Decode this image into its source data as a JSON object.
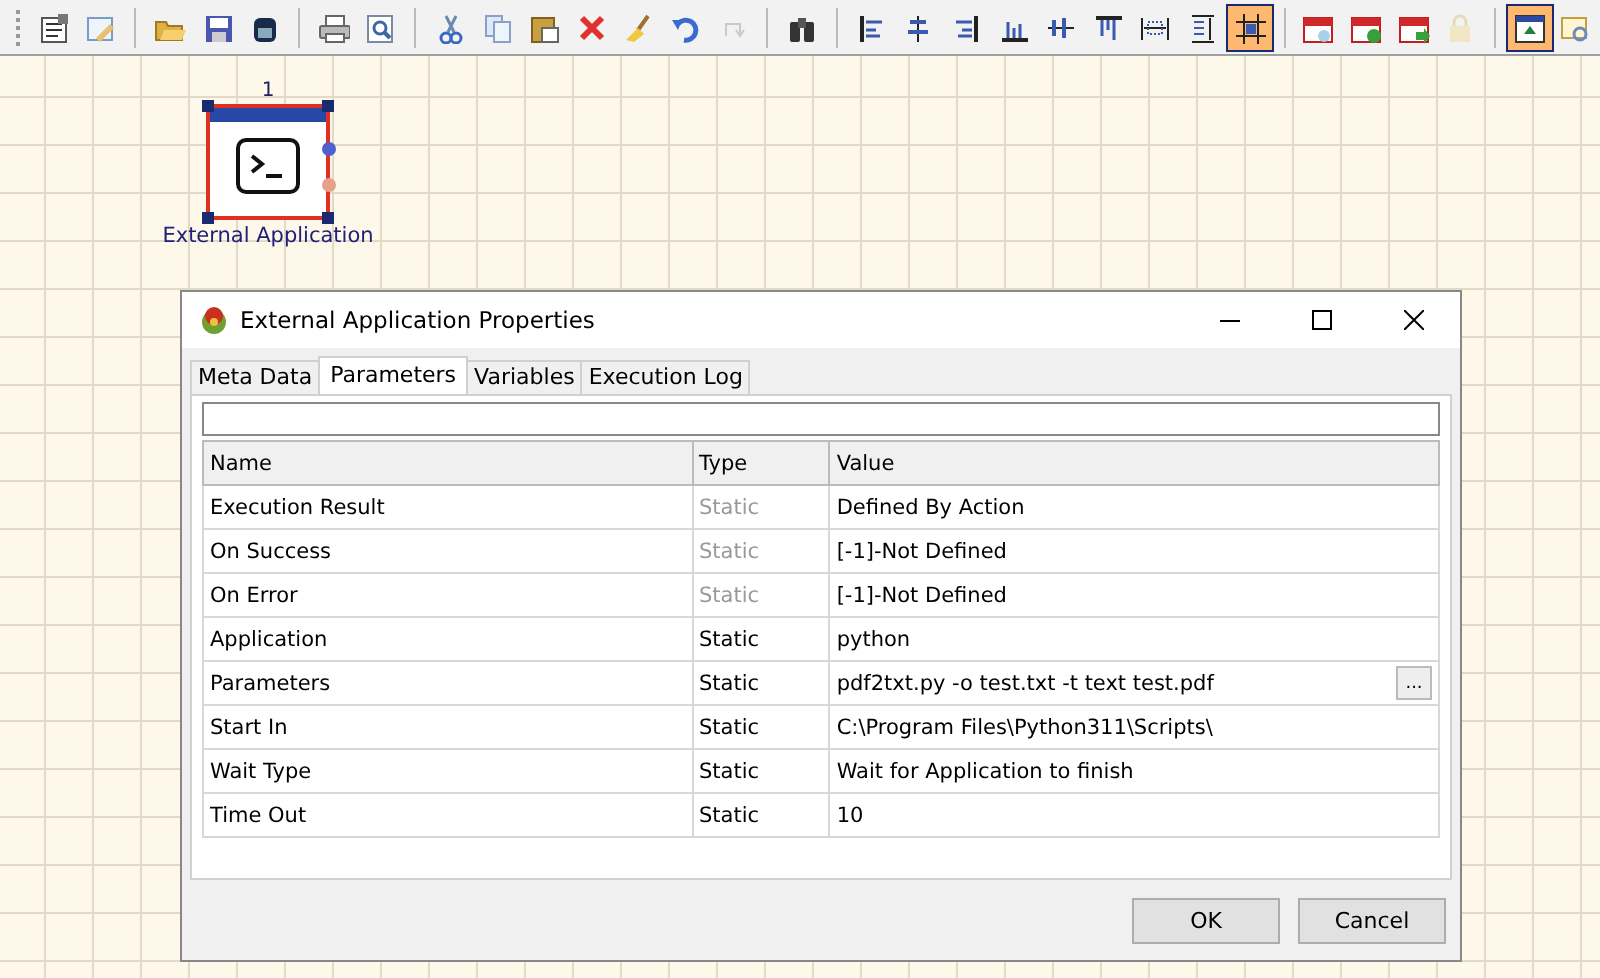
{
  "toolbar": [
    {
      "kind": "properties",
      "selected": false,
      "disabled": false
    },
    {
      "kind": "edit",
      "selected": false,
      "disabled": false
    },
    {
      "kind": "sep"
    },
    {
      "kind": "open",
      "selected": false,
      "disabled": false
    },
    {
      "kind": "save",
      "selected": false,
      "disabled": false
    },
    {
      "kind": "database",
      "selected": false,
      "disabled": false
    },
    {
      "kind": "sep"
    },
    {
      "kind": "print",
      "selected": false,
      "disabled": false
    },
    {
      "kind": "preview",
      "selected": false,
      "disabled": false
    },
    {
      "kind": "sep"
    },
    {
      "kind": "cut",
      "selected": false,
      "disabled": false
    },
    {
      "kind": "copy",
      "selected": false,
      "disabled": false
    },
    {
      "kind": "paste",
      "selected": false,
      "disabled": false
    },
    {
      "kind": "delete",
      "selected": false,
      "disabled": false
    },
    {
      "kind": "broom",
      "selected": false,
      "disabled": false
    },
    {
      "kind": "undo",
      "selected": false,
      "disabled": false
    },
    {
      "kind": "redo",
      "selected": false,
      "disabled": true
    },
    {
      "kind": "sep"
    },
    {
      "kind": "binoculars",
      "selected": false,
      "disabled": false
    },
    {
      "kind": "sep"
    },
    {
      "kind": "align-left",
      "selected": false,
      "disabled": false
    },
    {
      "kind": "align-center",
      "selected": false,
      "disabled": false
    },
    {
      "kind": "align-right",
      "selected": false,
      "disabled": false
    },
    {
      "kind": "align-bottom",
      "selected": false,
      "disabled": false
    },
    {
      "kind": "align-middle",
      "selected": false,
      "disabled": false
    },
    {
      "kind": "align-top",
      "selected": false,
      "disabled": false
    },
    {
      "kind": "same-width",
      "selected": false,
      "disabled": false
    },
    {
      "kind": "same-height",
      "selected": false,
      "disabled": false
    },
    {
      "kind": "grid-snap",
      "selected": true,
      "disabled": false
    },
    {
      "kind": "sep"
    },
    {
      "kind": "calendar-search",
      "selected": false,
      "disabled": false
    },
    {
      "kind": "calendar-add",
      "selected": false,
      "disabled": false
    },
    {
      "kind": "calendar-go",
      "selected": false,
      "disabled": false
    },
    {
      "kind": "lock",
      "selected": false,
      "disabled": true
    },
    {
      "kind": "sep"
    },
    {
      "kind": "window-up",
      "selected": true,
      "disabled": false
    },
    {
      "kind": "window-search",
      "selected": false,
      "disabled": false
    }
  ],
  "node": {
    "number": "1",
    "label": "External Application",
    "selected": true
  },
  "dialog": {
    "title": "External Application Properties",
    "tabs": [
      {
        "label": "Meta Data",
        "selected": false
      },
      {
        "label": "Parameters",
        "selected": true
      },
      {
        "label": "Variables",
        "selected": false
      },
      {
        "label": "Execution Log",
        "selected": false
      }
    ],
    "table": {
      "columns": [
        "Name",
        "Type",
        "Value"
      ],
      "rows": [
        {
          "name": "Execution Result",
          "type": "Static",
          "type_disabled": true,
          "value": "Defined By Action",
          "has_browse": false
        },
        {
          "name": "On Success",
          "type": "Static",
          "type_disabled": true,
          "value": "[-1]-Not Defined",
          "has_browse": false
        },
        {
          "name": "On Error",
          "type": "Static",
          "type_disabled": true,
          "value": "[-1]-Not Defined",
          "has_browse": false
        },
        {
          "name": "Application",
          "type": "Static",
          "type_disabled": false,
          "value": "python",
          "has_browse": false
        },
        {
          "name": "Parameters",
          "type": "Static",
          "type_disabled": false,
          "value": "pdf2txt.py -o test.txt -t text test.pdf",
          "has_browse": true,
          "browse_label": "..."
        },
        {
          "name": "Start In",
          "type": "Static",
          "type_disabled": false,
          "value": "C:\\Program Files\\Python311\\Scripts\\",
          "has_browse": false
        },
        {
          "name": "Wait Type",
          "type": "Static",
          "type_disabled": false,
          "value": "Wait for Application to finish",
          "has_browse": false
        },
        {
          "name": "Time Out",
          "type": "Static",
          "type_disabled": false,
          "value": "10",
          "has_browse": false
        }
      ]
    },
    "buttons": [
      "OK",
      "Cancel"
    ]
  }
}
